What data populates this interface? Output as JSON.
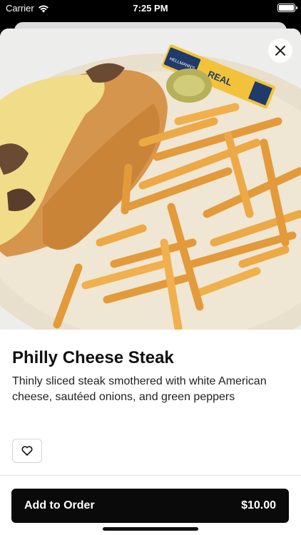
{
  "status_bar": {
    "carrier": "Carrier",
    "time": "7:25 PM"
  },
  "item": {
    "title": "Philly Cheese Steak",
    "description": "Thinly sliced steak smothered with white American cheese, sautéed onions, and green peppers",
    "image_condiment_text": "REAL",
    "image_condiment_brand": "HELLMANN'S"
  },
  "icons": {
    "close": "close-icon",
    "favorite": "heart-icon"
  },
  "order": {
    "label": "Add to Order",
    "price": "$10.00"
  },
  "colors": {
    "primary_button": "#0a0a0a",
    "background": "#ffffff"
  }
}
